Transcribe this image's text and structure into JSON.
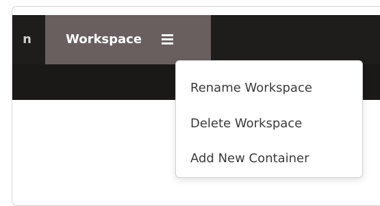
{
  "navbar": {
    "partial_item_label": "n",
    "active_item_label": "Workspace",
    "menu_icon": "hamburger-menu-icon"
  },
  "dropdown": {
    "items": [
      {
        "label": "Rename Workspace"
      },
      {
        "label": "Delete Workspace"
      },
      {
        "label": "Add New Container"
      }
    ]
  },
  "colors": {
    "navbar_bg": "#1f1c1c",
    "active_tab_bg": "#6a5f5f",
    "subbar_bg": "#1b1818",
    "menu_text": "#3a3a3a"
  }
}
